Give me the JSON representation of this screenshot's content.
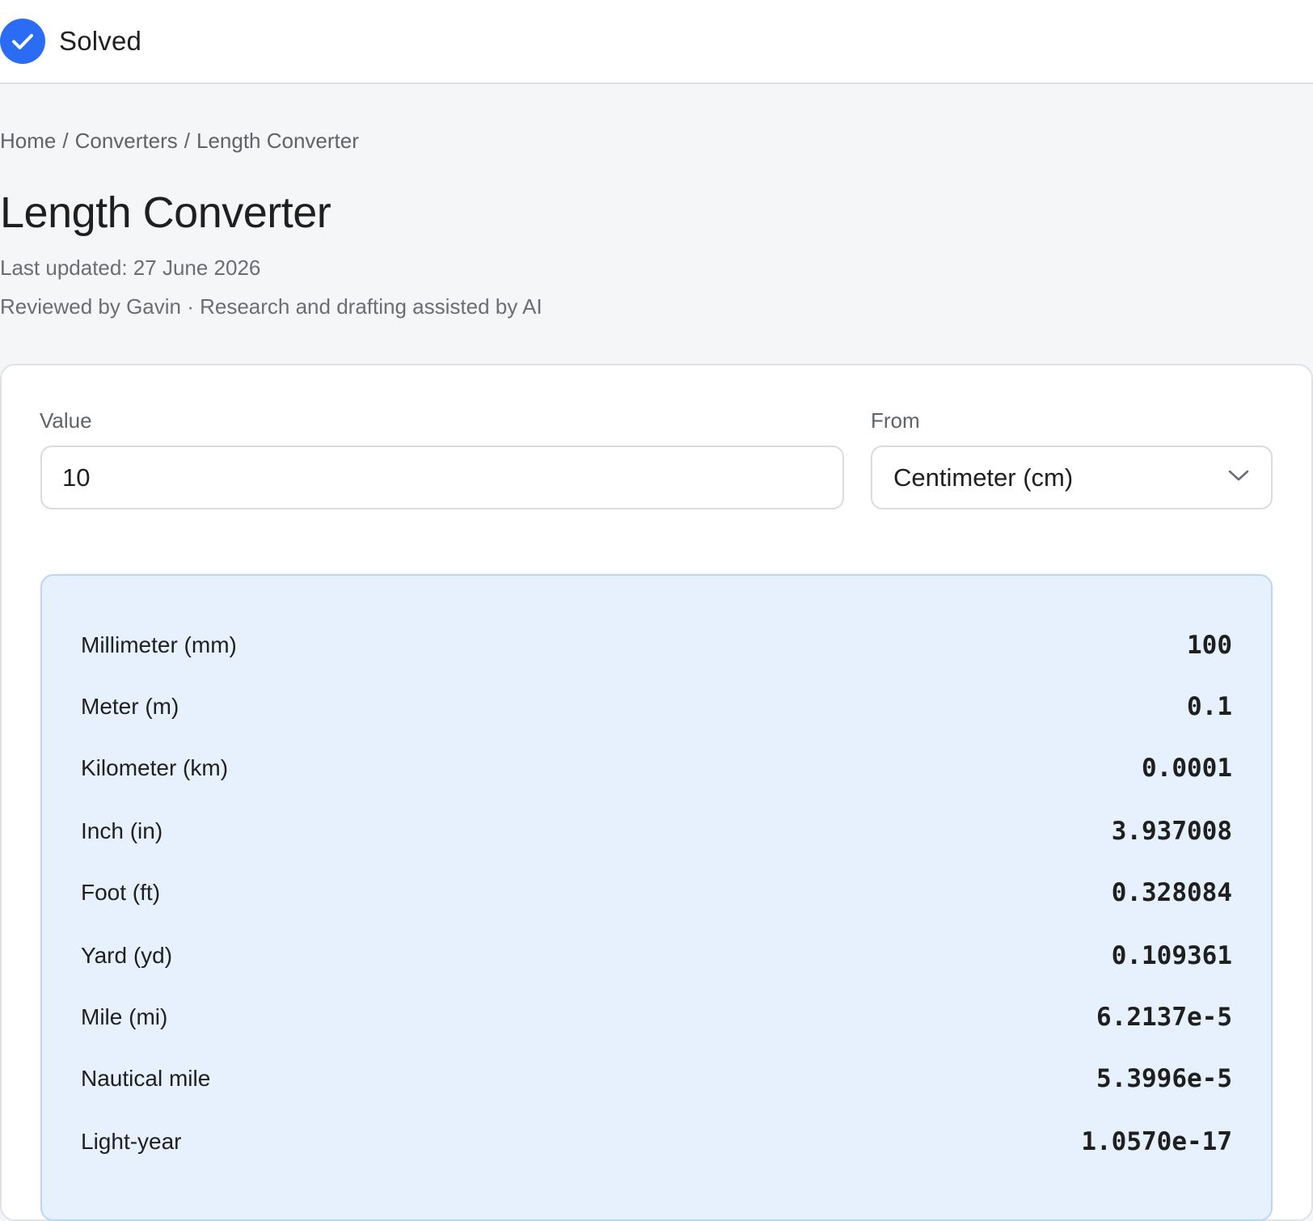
{
  "header": {
    "status": "Solved",
    "icon": "check-circle-icon",
    "accent": "#2a6df4"
  },
  "breadcrumb": [
    "Home",
    "Converters",
    "Length Converter"
  ],
  "page": {
    "title": "Length Converter",
    "last_updated": "Last updated: 27 June 2026",
    "review_note": "Reviewed by Gavin · Research and drafting assisted by AI"
  },
  "form": {
    "value_label": "Value",
    "value": "10",
    "from_label": "From",
    "from_selected": "Centimeter (cm)"
  },
  "results": [
    {
      "unit": "Millimeter (mm)",
      "value": "100"
    },
    {
      "unit": "Meter (m)",
      "value": "0.1"
    },
    {
      "unit": "Kilometer (km)",
      "value": "0.0001"
    },
    {
      "unit": "Inch (in)",
      "value": "3.937008"
    },
    {
      "unit": "Foot (ft)",
      "value": "0.328084"
    },
    {
      "unit": "Yard (yd)",
      "value": "0.109361"
    },
    {
      "unit": "Mile (mi)",
      "value": "6.2137e-5"
    },
    {
      "unit": "Nautical mile",
      "value": "5.3996e-5"
    },
    {
      "unit": "Light-year",
      "value": "1.0570e-17"
    }
  ]
}
